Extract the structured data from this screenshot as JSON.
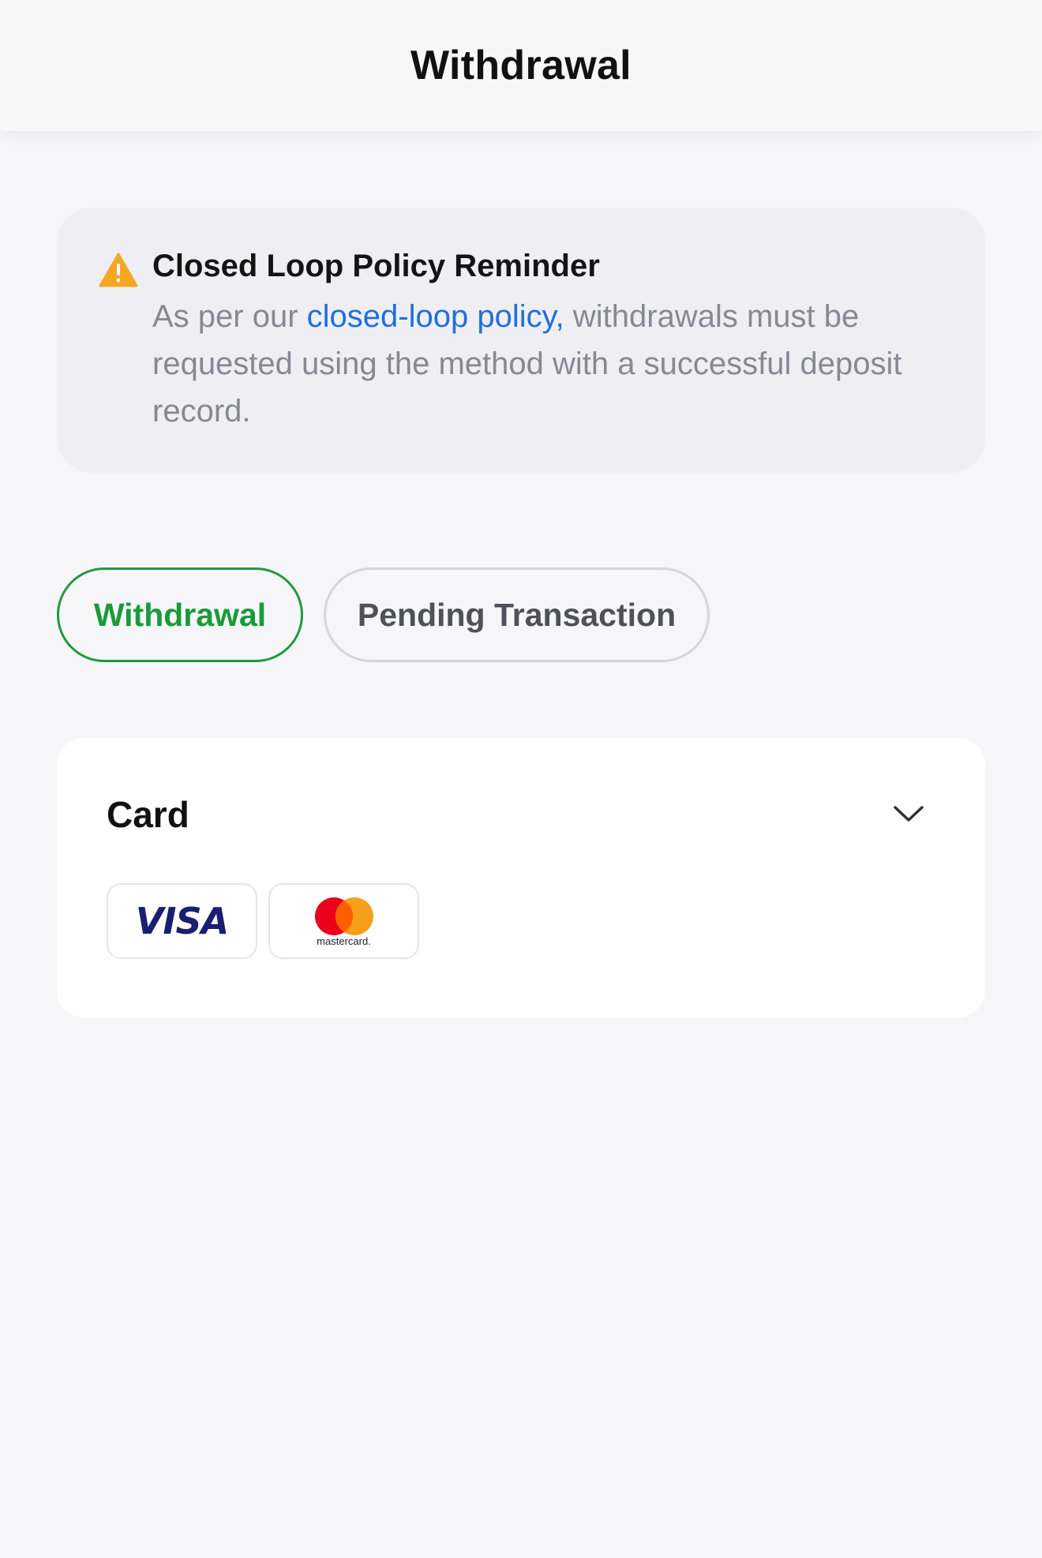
{
  "header": {
    "title": "Withdrawal"
  },
  "notice": {
    "icon": "warning-triangle-icon",
    "icon_color": "#f5a623",
    "title": "Closed Loop Policy Reminder",
    "body_prefix": "As per our ",
    "link_text": "closed-loop policy,",
    "body_suffix": " withdrawals must be requested using the method with a successful deposit record."
  },
  "tabs": [
    {
      "label": "Withdrawal",
      "active": true
    },
    {
      "label": "Pending Transaction",
      "active": false
    }
  ],
  "card_section": {
    "title": "Card",
    "expand_icon": "chevron-down-icon",
    "logos": [
      {
        "name": "VISA",
        "text": "VISA"
      },
      {
        "name": "mastercard",
        "text": "mastercard."
      }
    ]
  },
  "colors": {
    "accent_green": "#1a9a3a",
    "link_blue": "#1f6fe0",
    "visa_blue": "#1a1f71",
    "mc_red": "#eb001b",
    "mc_orange": "#f79e1b"
  }
}
